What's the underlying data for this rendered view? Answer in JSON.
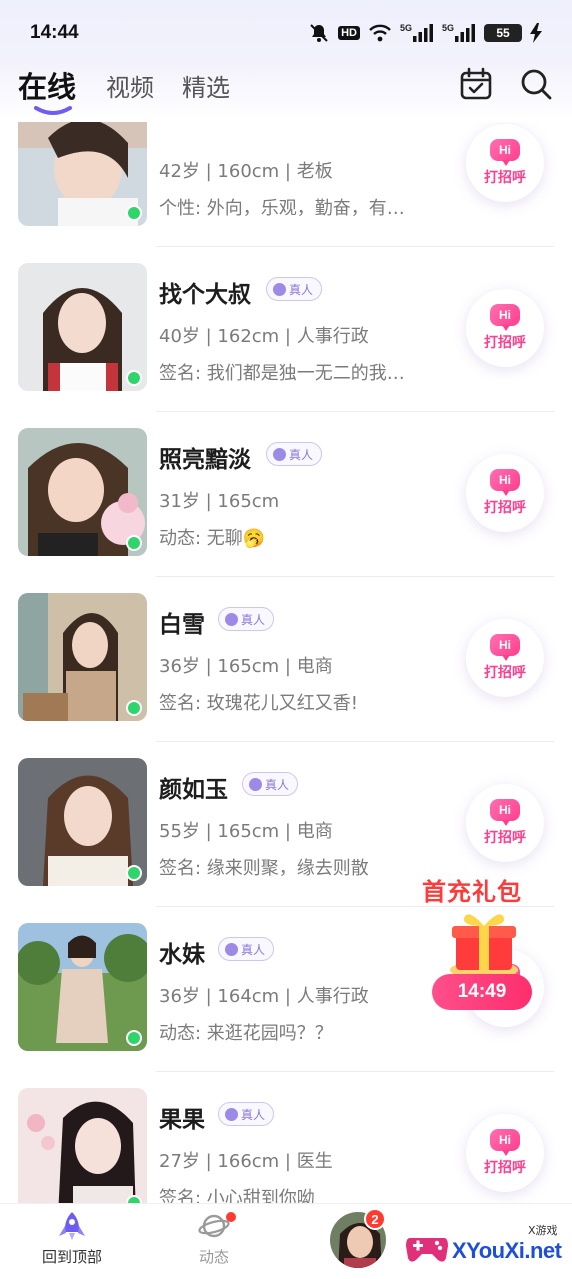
{
  "status_bar": {
    "time": "14:44",
    "hd_label": "HD",
    "net1": "5G",
    "net2": "5G",
    "battery": "55",
    "icons": [
      "mute-icon",
      "hd-icon",
      "wifi-icon",
      "signal-icon",
      "signal-icon",
      "battery-icon",
      "charging-icon"
    ]
  },
  "header": {
    "tabs": [
      {
        "label": "在线",
        "active": true
      },
      {
        "label": "视频",
        "active": false
      },
      {
        "label": "精选",
        "active": false
      }
    ],
    "icons": [
      "calendar-check-icon",
      "search-icon"
    ]
  },
  "list": {
    "verified_label": "真人",
    "greet_label": "打招呼",
    "hi_label": "Hi",
    "items": [
      {
        "name": "",
        "meta": "42岁 | 160cm | 老板",
        "sig": "个性: 外向，乐观，勤奋，有…",
        "verified": false
      },
      {
        "name": "找个大叔",
        "meta": "40岁 | 162cm | 人事行政",
        "sig": "签名: 我们都是独一无二的我…",
        "verified": true
      },
      {
        "name": "照亮黯淡",
        "meta": "31岁 | 165cm",
        "sig": "动态: 无聊🥱",
        "verified": true
      },
      {
        "name": "白雪",
        "meta": "36岁 | 165cm | 电商",
        "sig": "签名: 玫瑰花儿又红又香!",
        "verified": true
      },
      {
        "name": "颜如玉",
        "meta": "55岁 | 165cm | 电商",
        "sig": "签名: 缘来则聚，缘去则散",
        "verified": true
      },
      {
        "name": "水妹",
        "meta": "36岁 | 164cm | 人事行政",
        "sig": "动态: 来逛花园吗？？",
        "verified": true
      },
      {
        "name": "果果",
        "meta": "27岁 | 166cm | 医生",
        "sig": "签名: 小心甜到你呦",
        "verified": true
      }
    ]
  },
  "promo": {
    "title": "首充礼包",
    "timer": "14:49"
  },
  "bottom_nav": {
    "items": [
      {
        "label": "回到顶部",
        "icon": "rocket-icon"
      },
      {
        "label": "动态",
        "icon": "planet-icon"
      }
    ],
    "message_badge": "2"
  },
  "watermark": {
    "text": "XYouXi.net",
    "small": "X游戏"
  },
  "colors": {
    "accent": "#ff3f8e",
    "online": "#2fd46b",
    "verified": "#8a77d8"
  }
}
